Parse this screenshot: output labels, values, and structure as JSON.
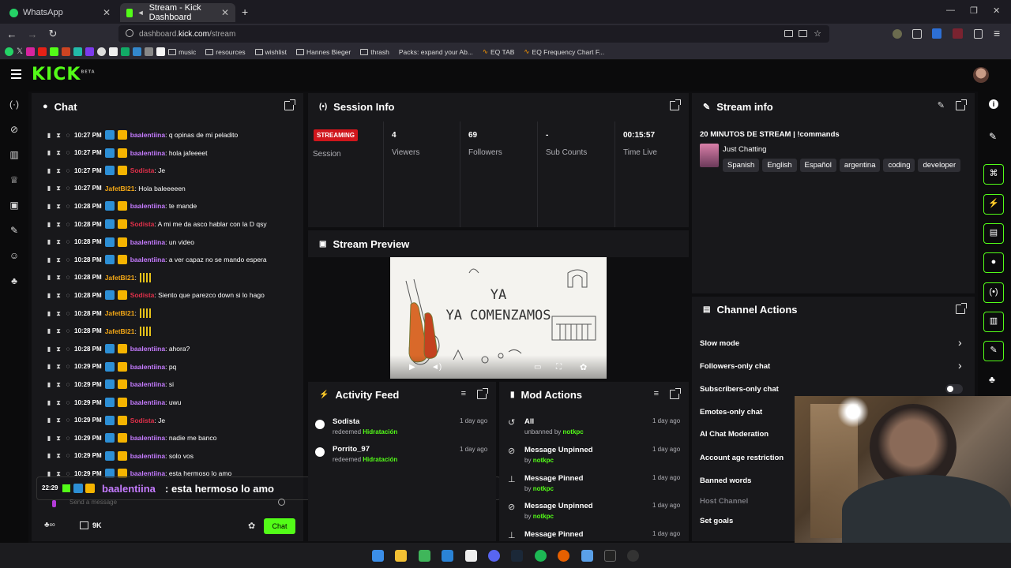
{
  "browser": {
    "tabs": [
      {
        "title": "WhatsApp"
      },
      {
        "title": "Stream - Kick Dashboard"
      }
    ],
    "url_prefix": "dashboard.",
    "url_domain": "kick.com",
    "url_path": "/stream",
    "bookmarks": [
      "music",
      "resources",
      "wishlist",
      "Hannes Bieger",
      "thrash",
      "Packs: expand your Ab...",
      "EQ TAB",
      "EQ Frequency Chart F..."
    ]
  },
  "app": {
    "logo": "KICK",
    "logo_sup": "BETA"
  },
  "chat": {
    "title": "Chat",
    "messages": [
      {
        "time": "10:27 PM",
        "user": "baalentiina",
        "color": "pink",
        "text": ": q opinas de mi peladito",
        "badges": true
      },
      {
        "time": "10:27 PM",
        "user": "baalentiina",
        "color": "pink",
        "text": ": hola jafeeeet",
        "badges": true
      },
      {
        "time": "10:27 PM",
        "user": "Sodista",
        "color": "red",
        "text": ": Je",
        "badges": true
      },
      {
        "time": "10:27 PM",
        "user": "JafetBI21",
        "color": "gold",
        "text": ": Hola baleeeeen",
        "badges": false
      },
      {
        "time": "10:28 PM",
        "user": "baalentiina",
        "color": "pink",
        "text": ": te mande",
        "badges": true
      },
      {
        "time": "10:28 PM",
        "user": "Sodista",
        "color": "red",
        "text": ": A mi me da asco hablar con la D qsy",
        "badges": true
      },
      {
        "time": "10:28 PM",
        "user": "baalentiina",
        "color": "pink",
        "text": ": un video",
        "badges": true
      },
      {
        "time": "10:28 PM",
        "user": "baalentiina",
        "color": "pink",
        "text": ": a ver capaz no se mando espera",
        "badges": true
      },
      {
        "time": "10:28 PM",
        "user": "JafetBI21",
        "color": "gold",
        "text": ":",
        "badges": false,
        "emote": true
      },
      {
        "time": "10:28 PM",
        "user": "Sodista",
        "color": "red",
        "text": ": Siento que parezco down si lo hago",
        "badges": true
      },
      {
        "time": "10:28 PM",
        "user": "JafetBI21",
        "color": "gold",
        "text": ":",
        "badges": false,
        "emote": true
      },
      {
        "time": "10:28 PM",
        "user": "JafetBI21",
        "color": "gold",
        "text": ":",
        "badges": false,
        "emote": true
      },
      {
        "time": "10:28 PM",
        "user": "baalentiina",
        "color": "pink",
        "text": ": ahora?",
        "badges": true
      },
      {
        "time": "10:29 PM",
        "user": "baalentiina",
        "color": "pink",
        "text": ": pq",
        "badges": true
      },
      {
        "time": "10:29 PM",
        "user": "baalentiina",
        "color": "pink",
        "text": ": si",
        "badges": true
      },
      {
        "time": "10:29 PM",
        "user": "baalentiina",
        "color": "pink",
        "text": ": uwu",
        "badges": true
      },
      {
        "time": "10:29 PM",
        "user": "Sodista",
        "color": "red",
        "text": ": Je",
        "badges": true
      },
      {
        "time": "10:29 PM",
        "user": "baalentiina",
        "color": "pink",
        "text": ": nadie me banco",
        "badges": true
      },
      {
        "time": "10:29 PM",
        "user": "baalentiina",
        "color": "pink",
        "text": ": solo vos",
        "badges": true
      },
      {
        "time": "10:29 PM",
        "user": "baalentiina",
        "color": "pink",
        "text": ": esta hermoso lo amo",
        "badges": true
      }
    ],
    "overlay": {
      "time": "22:29",
      "user": "baalentiina",
      "text": ": esta hermoso lo amo"
    },
    "input_placeholder": "Send a message",
    "points": "9K",
    "send_label": "Chat"
  },
  "session": {
    "title": "Session Info",
    "streaming_badge": "STREAMING",
    "session_label": "Session",
    "stats": [
      {
        "value": "4",
        "label": "Viewers"
      },
      {
        "value": "69",
        "label": "Followers"
      },
      {
        "value": "-",
        "label": "Sub Counts"
      },
      {
        "value": "00:15:57",
        "label": "Time Live"
      }
    ]
  },
  "preview": {
    "title": "Stream Preview",
    "line1": "YA",
    "line2": "YA COMENZAMOS"
  },
  "stream_info": {
    "title": "Stream info",
    "stream_title": "20 MINUTOS DE STREAM | !commands",
    "category": "Just Chatting",
    "tags": [
      "Spanish",
      "English",
      "Español",
      "argentina",
      "coding",
      "developer"
    ]
  },
  "channel_actions": {
    "title": "Channel Actions",
    "items": [
      {
        "label": "Slow mode",
        "chevron": true
      },
      {
        "label": "Followers-only chat",
        "chevron": true
      },
      {
        "label": "Subscribers-only chat",
        "toggle": true
      },
      {
        "label": "Emotes-only chat"
      },
      {
        "label": "AI Chat Moderation"
      },
      {
        "label": "Account age restriction"
      },
      {
        "label": "Banned words"
      },
      {
        "label": "Host Channel",
        "dim": true
      },
      {
        "label": "Set goals"
      }
    ]
  },
  "activity": {
    "title": "Activity Feed",
    "items": [
      {
        "name": "Sodista",
        "action": "redeemed",
        "reward": "Hidratación",
        "ago": "1 day ago"
      },
      {
        "name": "Porrito_97",
        "action": "redeemed",
        "reward": "Hidratación",
        "ago": "1 day ago"
      }
    ]
  },
  "mod": {
    "title": "Mod Actions",
    "items": [
      {
        "name": "All",
        "action": "unbanned by",
        "by": "notkpc",
        "ago": "1 day ago"
      },
      {
        "name": "Message Unpinned",
        "action": "by",
        "by": "notkpc",
        "ago": "1 day ago"
      },
      {
        "name": "Message Pinned",
        "action": "by",
        "by": "notkpc",
        "ago": "1 day ago"
      },
      {
        "name": "Message Unpinned",
        "action": "by",
        "by": "notkpc",
        "ago": "1 day ago"
      },
      {
        "name": "Message Pinned",
        "action": "",
        "by": "",
        "ago": "1 day ago"
      }
    ]
  },
  "colors": {
    "accent": "#53fc18",
    "panel": "#18181b",
    "bg": "#0e0e10",
    "streaming": "#d0161c",
    "pink_user": "#c57bff",
    "red_user": "#e0304a",
    "gold_user": "#f3a716"
  }
}
